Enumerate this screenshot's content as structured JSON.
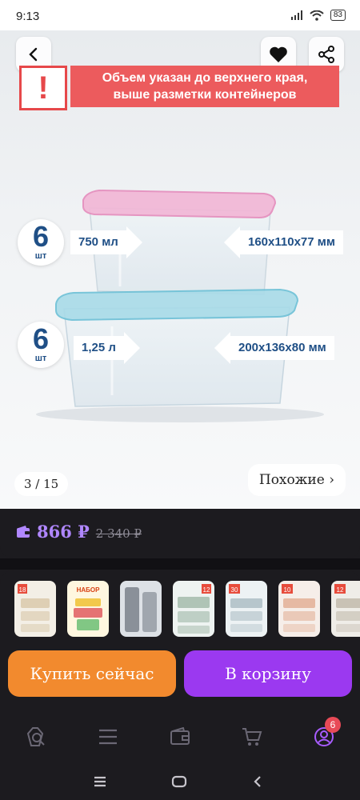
{
  "status_bar": {
    "time": "9:13",
    "battery": "83"
  },
  "hero": {
    "warning_mark": "!",
    "warning_line1": "Объем указан до верхнего края,",
    "warning_line2": "выше разметки контейнеров",
    "containers": [
      {
        "qty": "6",
        "unit": "шт",
        "volume": "750 мл",
        "dimensions": "160x110x77 мм"
      },
      {
        "qty": "6",
        "unit": "шт",
        "volume": "1,25 л",
        "dimensions": "200x136x80 мм"
      }
    ],
    "counter": "3 / 15",
    "similar_label": "Похожие ›"
  },
  "price": {
    "current": "866 ₽",
    "old": "2 340 ₽"
  },
  "thumbnails": [
    {
      "label": "18",
      "accent": "#d8c7a8"
    },
    {
      "label": "НАБОР",
      "accent": "#f2c94c"
    },
    {
      "label": "",
      "accent": "#8a9099"
    },
    {
      "label": "12",
      "accent": "#9fb8a8"
    },
    {
      "label": "30",
      "accent": "#b7c6cc"
    },
    {
      "label": "10",
      "accent": "#e6b9a3"
    },
    {
      "label": "12",
      "accent": "#c9c2b5"
    }
  ],
  "actions": {
    "buy_now": "Купить сейчас",
    "add_to_cart": "В корзину"
  },
  "nav": {
    "profile_badge": "6"
  },
  "colors": {
    "accent_purple": "#9b39f0",
    "accent_orange": "#f28a2e",
    "warning_red": "#ec5b5d",
    "price_purple": "#b087ff"
  }
}
